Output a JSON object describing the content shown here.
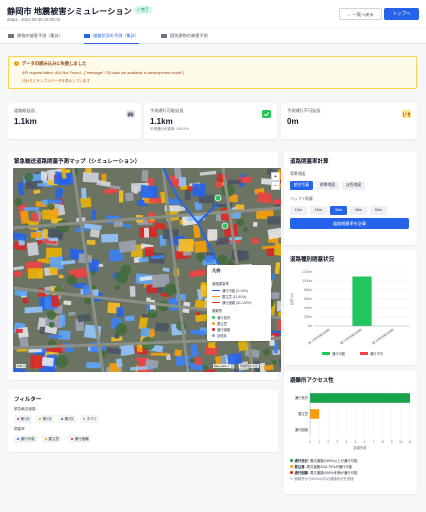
{
  "header": {
    "title": "静岡市 地震被害シミュレーション",
    "status_badge": "✓ 完了",
    "subtitle": "data1 - 2021-09-30 16:00:00",
    "back_button": "← 一覧へ戻る",
    "top_button": "トップへ"
  },
  "tabs": [
    {
      "label": "建物の被害予測（集計）",
      "active": false
    },
    {
      "label": "道路状況の予測（集計）",
      "active": true
    },
    {
      "label": "個別建物の被害予測",
      "active": false
    }
  ],
  "alert": {
    "icon": "!",
    "title": "データの読み込みに失敗しました",
    "message": "API request failed: 404 Not Found - {\"message\":\"S3 data not available in development mode\"}",
    "note": "代わりにサンプルデータを表示しています"
  },
  "stats": [
    {
      "label": "道路総延長",
      "value": "1.1km",
      "sub": "",
      "icon": "car-icon",
      "color": "#9ca3af"
    },
    {
      "label": "予測通行可能延長",
      "value": "1.1km",
      "sub": "予測通行可能率: 100.0%",
      "icon": "check-icon",
      "color": "#22c55e"
    },
    {
      "label": "予測通行不可延長",
      "value": "0m",
      "sub": "",
      "icon": "barrier-icon",
      "color": "#d97706"
    }
  ],
  "map_card": {
    "title": "緊急輸送道路閉塞予測マップ（シミュレーション）",
    "zoom_in": "+",
    "zoom_out": "−",
    "scale": "100 m",
    "attribution": "Map data ©",
    "attribution2": "地理院タイル",
    "legend": {
      "title": "凡例",
      "road_header": "道路閉塞率",
      "roads": [
        {
          "label": "通行可能 (0-10%)",
          "color": "#2563eb"
        },
        {
          "label": "要注意 (11-50%)",
          "color": "#f59e0b"
        },
        {
          "label": "通行困難 (51-100%)",
          "color": "#dc2626"
        }
      ],
      "shelter_header": "避難所",
      "shelters": [
        {
          "label": "通行良好",
          "color": "#22c55e"
        },
        {
          "label": "要注意",
          "color": "#f59e0b"
        },
        {
          "label": "通行困難",
          "color": "#dc2626"
        },
        {
          "label": "評価前",
          "color": "#9ca3af"
        }
      ]
    }
  },
  "calc": {
    "title": "道路閉塞率計算",
    "bg_label": "背景地図",
    "bg_options": [
      "航空写真",
      "標準地図",
      "淡色地図"
    ],
    "bg_selected": 0,
    "buffer_label": "バッファ距離",
    "buffer_options": [
      "10m",
      "20m",
      "30m",
      "40m",
      "50m"
    ],
    "buffer_selected": 2,
    "button": "道路閉塞率を計算"
  },
  "road_chart": {
    "title": "道路種別閉塞状況",
    "chart_data": {
      "type": "bar",
      "stacked": true,
      "categories": [
        "第1次緊急輸送道路",
        "第2次緊急輸送道路",
        "第3次緊急輸送道路"
      ],
      "series": [
        {
          "name": "通行可能",
          "color": "#22c55e",
          "values": [
            0,
            1100,
            0
          ]
        },
        {
          "name": "通行不可",
          "color": "#ef4444",
          "values": [
            0,
            0,
            0
          ]
        }
      ],
      "ylabel": "延長 (m)",
      "yticks": [
        "0m",
        "200m",
        "400m",
        "600m",
        "800m",
        "1000m",
        "1200m"
      ],
      "ylim": [
        0,
        1200
      ]
    }
  },
  "shelter_chart": {
    "title": "避難所アクセス性",
    "chart_data": {
      "type": "bar",
      "orientation": "horizontal",
      "categories": [
        "通行良好",
        "要注意",
        "通行困難"
      ],
      "values": [
        11,
        1,
        0
      ],
      "colors": [
        "#16a34a",
        "#f59e0b",
        "#dc2626"
      ],
      "xlim": [
        0,
        11
      ],
      "xticks": [
        "0",
        "1",
        "2",
        "3",
        "4",
        "5",
        "6",
        "7",
        "8",
        "9",
        "10",
        "11"
      ],
      "xlabel": "避難所数"
    },
    "notes": [
      {
        "bold": "通行良好",
        "text": ": 周辺道路の80%以上が通行可能",
        "color": "#16a34a"
      },
      {
        "bold": "要注意",
        "text": ": 周辺道路の50-79%が通行可能",
        "color": "#f59e0b"
      },
      {
        "bold": "通行困難",
        "text": ": 周辺道路の50%未満が通行可能",
        "color": "#dc2626"
      }
    ],
    "footnote": "※ 避難所から500m以内の道路状況を評価"
  },
  "filter": {
    "title": "フィルター",
    "group1_label": "緊急輸送道路",
    "group1": [
      {
        "label": "第1次",
        "color": "#dc2626"
      },
      {
        "label": "第2次",
        "color": "#f59e0b"
      },
      {
        "label": "第3次",
        "color": "#2563eb"
      },
      {
        "label": "すべて",
        "color": "#9ca3af"
      }
    ],
    "group2_label": "閉塞率",
    "group2": [
      {
        "label": "通行可能",
        "color": "#2563eb"
      },
      {
        "label": "要注意",
        "color": "#f59e0b"
      },
      {
        "label": "通行困難",
        "color": "#dc2626"
      }
    ]
  }
}
